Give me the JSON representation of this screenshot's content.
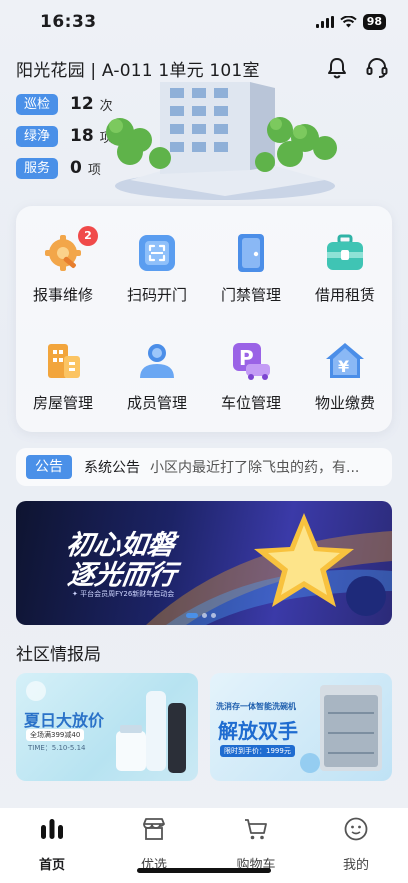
{
  "status_bar": {
    "time": "16:33",
    "battery": "98"
  },
  "header": {
    "title": "阳光花园 | A-011 1单元 101室"
  },
  "stats": [
    {
      "tag": "巡检",
      "value": "12",
      "unit": "次"
    },
    {
      "tag": "绿浄",
      "value": "18",
      "unit": "项"
    },
    {
      "tag": "服务",
      "value": "0",
      "unit": "项"
    }
  ],
  "services": [
    {
      "label": "报事维修",
      "badge": "2"
    },
    {
      "label": "扫码开门"
    },
    {
      "label": "门禁管理"
    },
    {
      "label": "借用租赁"
    },
    {
      "label": "房屋管理"
    },
    {
      "label": "成员管理"
    },
    {
      "label": "车位管理"
    },
    {
      "label": "物业缴费"
    }
  ],
  "notice": {
    "tag": "公告",
    "title": "系统公告",
    "text": "小区内最近打了除飞虫的药，有..."
  },
  "banner": {
    "line1": "初心如磐",
    "line2": "逐光而行",
    "sub": "✦ 平台会员周FY26新财年启动会",
    "slide": 1,
    "slides": 3
  },
  "section": {
    "title": "社区情报局"
  },
  "promos": [
    {
      "title": "夏日大放价",
      "line1": "全场满399减40",
      "line2": "TIME：5.10-5.14"
    },
    {
      "title": "解放双手",
      "line1": "洗消存一体智能洗碗机",
      "line2": "限时到手价：1999元"
    }
  ],
  "tabbar": [
    {
      "label": "首页",
      "icon": "home-bars-icon",
      "active": true
    },
    {
      "label": "优选",
      "icon": "store-icon"
    },
    {
      "label": "购物车",
      "icon": "cart-icon"
    },
    {
      "label": "我的",
      "icon": "face-icon"
    }
  ],
  "colors": {
    "accent": "#4a90e8",
    "badge": "#f04a4a"
  }
}
